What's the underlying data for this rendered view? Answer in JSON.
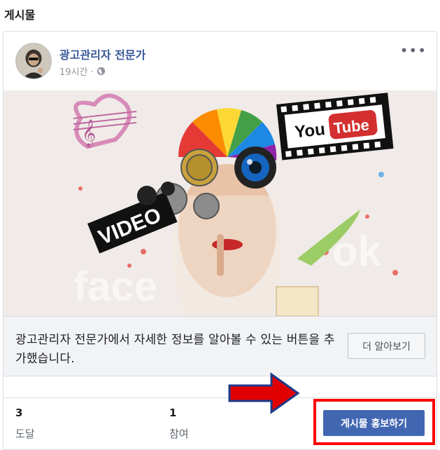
{
  "section": {
    "title": "게시물"
  },
  "post": {
    "author": "광고관리자 전문가",
    "time": "19시간 ·",
    "more_label": "•••"
  },
  "cta": {
    "text": "광고관리자 전문가에서 자세한 정보를 알아볼 수 있는 버튼을 추가했습니다.",
    "learn_more_label": "더 알아보기"
  },
  "stats": {
    "reach": {
      "value": "3",
      "label": "도달"
    },
    "engagement": {
      "value": "1",
      "label": "참여"
    }
  },
  "promote": {
    "label": "게시물 홍보하기"
  },
  "colors": {
    "link": "#385898",
    "primary": "#4267b2",
    "highlight": "#ff0000",
    "arrow": "#e00000"
  }
}
